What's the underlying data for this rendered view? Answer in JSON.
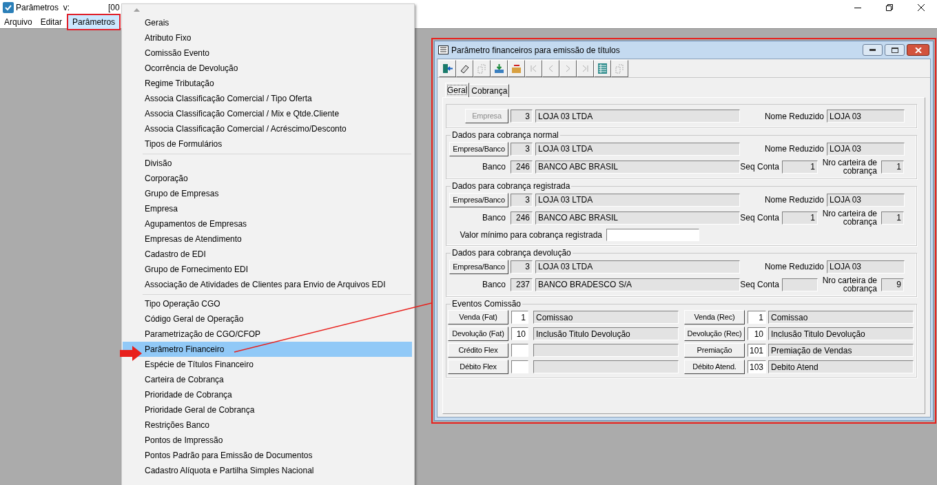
{
  "app": {
    "title": "Parâmetros  v:",
    "title_extra": "[00"
  },
  "menu_bar": [
    {
      "label": "Arquivo",
      "selected": false
    },
    {
      "label": "Editar",
      "selected": false
    },
    {
      "label": "Parâmetros",
      "selected": true
    }
  ],
  "dropdown": {
    "groups": [
      [
        {
          "label": "Gerais",
          "selected": false
        },
        {
          "label": "Atributo Fixo",
          "selected": false
        },
        {
          "label": "Comissão Evento",
          "selected": false
        },
        {
          "label": "Ocorrência de Devolução",
          "selected": false
        },
        {
          "label": "Regime Tributação",
          "selected": false
        },
        {
          "label": "Associa Classificação Comercial / Tipo Oferta",
          "selected": false
        },
        {
          "label": "Associa Classificação Comercial / Mix e Qtde.Cliente",
          "selected": false
        },
        {
          "label": "Associa Classificação Comercial / Acréscimo/Desconto",
          "selected": false
        },
        {
          "label": "Tipos de Formulários",
          "selected": false
        }
      ],
      [
        {
          "label": "Divisão",
          "selected": false
        },
        {
          "label": "Corporação",
          "selected": false
        },
        {
          "label": "Grupo de Empresas",
          "selected": false
        },
        {
          "label": "Empresa",
          "selected": false
        },
        {
          "label": "Agupamentos de Empresas",
          "selected": false
        },
        {
          "label": "Empresas de Atendimento",
          "selected": false
        },
        {
          "label": "Cadastro de EDI",
          "selected": false
        },
        {
          "label": "Grupo de Fornecimento EDI",
          "selected": false
        },
        {
          "label": "Associação de Atividades de Clientes para Envio de Arquivos EDI",
          "selected": false
        }
      ],
      [
        {
          "label": "Tipo Operação CGO",
          "selected": false
        },
        {
          "label": "Código Geral de Operação",
          "selected": false
        },
        {
          "label": "Parametrização de CGO/CFOP",
          "selected": false
        },
        {
          "label": "Parâmetro Financeiro",
          "selected": true
        },
        {
          "label": "Espécie de Títulos Financeiro",
          "selected": false
        },
        {
          "label": "Carteira de Cobrança",
          "selected": false
        },
        {
          "label": "Prioridade de Cobrança",
          "selected": false
        },
        {
          "label": "Prioridade Geral de Cobrança",
          "selected": false
        },
        {
          "label": "Restrições Banco",
          "selected": false
        },
        {
          "label": "Pontos de Impressão",
          "selected": false
        },
        {
          "label": "Pontos Padrão para Emissão de Documentos",
          "selected": false
        },
        {
          "label": "Cadastro Alíquota e Partilha Simples Nacional",
          "selected": false
        }
      ]
    ]
  },
  "dialog": {
    "title": "Parâmetro financeiros para emissão de títulos",
    "toolbar": [
      {
        "kind": "exit",
        "disabled": false
      },
      {
        "kind": "eraser",
        "disabled": false
      },
      {
        "kind": "copy",
        "disabled": true
      },
      {
        "kind": "import",
        "disabled": false
      },
      {
        "kind": "remove",
        "disabled": false
      },
      {
        "kind": "first",
        "disabled": true
      },
      {
        "kind": "prev",
        "disabled": true
      },
      {
        "kind": "next",
        "disabled": true
      },
      {
        "kind": "last",
        "disabled": true
      },
      {
        "kind": "grid",
        "disabled": false
      },
      {
        "kind": "copy",
        "disabled": true
      }
    ],
    "tabs": [
      {
        "label": "Geral",
        "selected": true
      },
      {
        "label": "Cobrança",
        "selected": false
      }
    ],
    "empresa": {
      "button": "Empresa",
      "button_disabled": true,
      "code": "3",
      "name": "LOJA 03 LTDA",
      "short_label": "Nome Reduzido",
      "short_name": "LOJA 03"
    },
    "groups": [
      {
        "title": "Dados para cobrança normal",
        "button": "Empresa/Banco",
        "code": "3",
        "name": "LOJA 03 LTDA",
        "short_label": "Nome Reduzido",
        "short_name": "LOJA 03",
        "bank_label": "Banco",
        "bank_code": "246",
        "bank_name": "BANCO ABC BRASIL",
        "seq_label": "Seq Conta",
        "seq": "1",
        "wallet_label": "Nro carteira de cobrança",
        "wallet": "1"
      },
      {
        "title": "Dados para cobrança registrada",
        "button": "Empresa/Banco",
        "code": "3",
        "name": "LOJA 03 LTDA",
        "short_label": "Nome Reduzido",
        "short_name": "LOJA 03",
        "bank_label": "Banco",
        "bank_code": "246",
        "bank_name": "BANCO ABC BRASIL",
        "seq_label": "Seq Conta",
        "seq": "1",
        "wallet_label": "Nro carteira de cobrança",
        "wallet": "1",
        "min_label": "Valor mínimo para cobrança registrada"
      },
      {
        "title": "Dados para cobrança devolução",
        "button": "Empresa/Banco",
        "code": "3",
        "name": "LOJA 03 LTDA",
        "short_label": "Nome Reduzido",
        "short_name": "LOJA 03",
        "bank_label": "Banco",
        "bank_code": "237",
        "bank_name": "BANCO BRADESCO S/A",
        "seq_label": "Seq Conta",
        "wallet_label": "Nro carteira de cobrança",
        "wallet": "9"
      }
    ],
    "eventos": {
      "title": "Eventos Comissão",
      "items": [
        {
          "button": "Venda (Fat)",
          "code": "1",
          "description": "Comissao"
        },
        {
          "button": "Venda (Rec)",
          "code": "1",
          "description": "Comissao"
        },
        {
          "button": "Devolução (Fat)",
          "code": "10",
          "description": "Inclusão Titulo Devolução"
        },
        {
          "button": "Devolução (Rec)",
          "code": "10",
          "description": "Inclusão Titulo Devolução"
        },
        {
          "button": "Crédito Flex"
        },
        {
          "button": "Premiação",
          "code": "101",
          "description": "Premiação de Vendas"
        },
        {
          "button": "Débito Flex"
        },
        {
          "button": "Débito Atend.",
          "code": "103",
          "description": "Debito Atend"
        }
      ]
    }
  }
}
